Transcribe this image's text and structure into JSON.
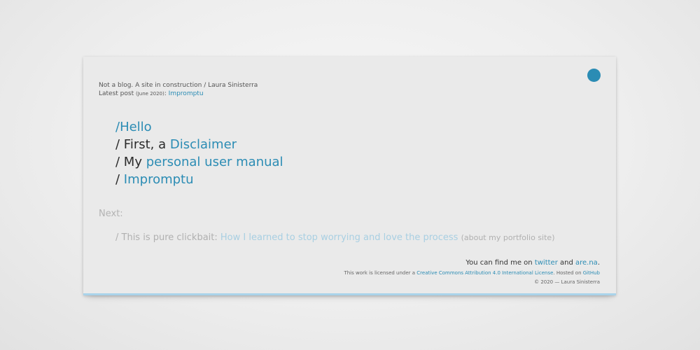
{
  "colors": {
    "accent": "#2b8cb4",
    "muted_link": "#a8cfe2",
    "text": "#2b2b2b",
    "muted_text": "#b3b3b3"
  },
  "header": {
    "tagline": "Not a blog. A site in construction / Laura Sinisterra",
    "latest_prefix": "Latest post",
    "latest_date": "(June 2020)",
    "latest_colon": ":",
    "latest_link": "Impromptu"
  },
  "nav": {
    "items": [
      {
        "prefix": "",
        "link": "/Hello"
      },
      {
        "prefix": "/ First, a ",
        "link": "Disclaimer"
      },
      {
        "prefix": "/ My ",
        "link": "personal user manual"
      },
      {
        "prefix": "/ ",
        "link": "Impromptu"
      }
    ]
  },
  "next": {
    "label": "Next:",
    "prefix": "/ This is pure clickbait: ",
    "link": "How I learned to stop worrying and love the process",
    "note": "(about my portfolio site)"
  },
  "footer": {
    "find_prefix": "You can find me on ",
    "twitter": "twitter",
    "and": " and ",
    "arena": "are.na",
    "period": ".",
    "license_prefix": "This work is licensed under a ",
    "license_link": "Creative Commons Attribution 4.0 International License",
    "hosted": ". Hosted on ",
    "github": "GitHub",
    "copyright": "© 2020 — Laura Sinisterra"
  }
}
